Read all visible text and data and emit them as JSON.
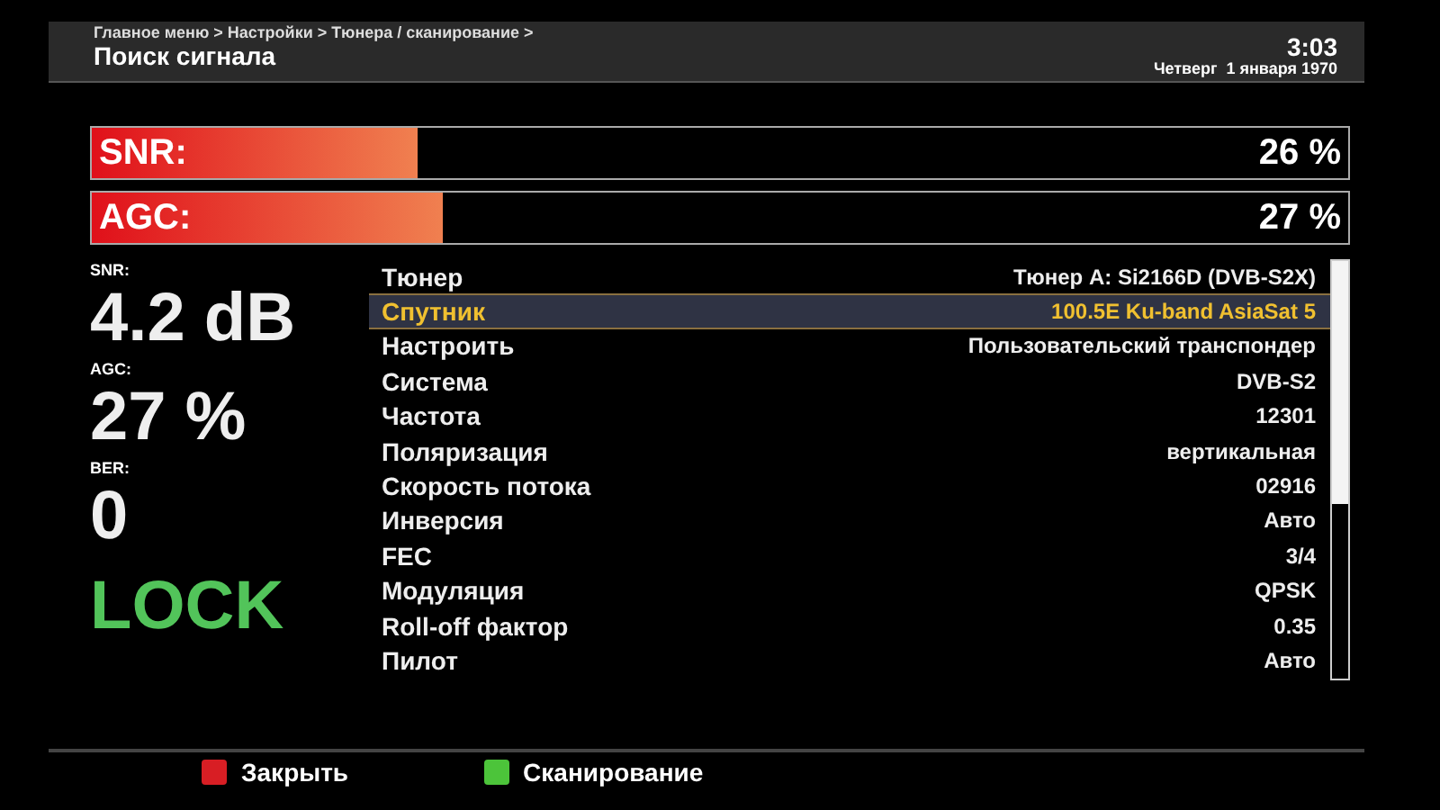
{
  "header": {
    "breadcrumb": "Главное меню > Настройки > Тюнера / сканирование >",
    "title": "Поиск сигнала",
    "time": "3:03",
    "date": "Четверг  1 января 1970"
  },
  "meters": [
    {
      "label": "SNR:",
      "level": 0.26,
      "reading": "26 %"
    },
    {
      "label": "AGC:",
      "level": 0.28,
      "reading": "27 %"
    }
  ],
  "stats": [
    {
      "label": "SNR:",
      "value": "4.2 dB",
      "kind": "value"
    },
    {
      "label": "AGC:",
      "value": "27 %",
      "kind": "value"
    },
    {
      "label": "BER:",
      "value": "0",
      "kind": "value"
    },
    {
      "value": "LOCK",
      "kind": "lock"
    }
  ],
  "settings": [
    {
      "name": "Тюнер",
      "value": "Тюнер A: Si2166D (DVB-S2X)",
      "selected": false
    },
    {
      "name": "Спутник",
      "value": "100.5E Ku-band AsiaSat 5",
      "selected": true
    },
    {
      "name": "Настроить",
      "value": "Пользовательский транспондер",
      "selected": false
    },
    {
      "name": "Система",
      "value": "DVB-S2",
      "selected": false
    },
    {
      "name": "Частота",
      "value": "12301",
      "selected": false
    },
    {
      "name": "Поляризация",
      "value": "вертикальная",
      "selected": false
    },
    {
      "name": "Скорость потока",
      "value": "02916",
      "selected": false
    },
    {
      "name": "Инверсия",
      "value": "Авто",
      "selected": false
    },
    {
      "name": "FEC",
      "value": "3/4",
      "selected": false
    },
    {
      "name": "Модуляция",
      "value": "QPSK",
      "selected": false
    },
    {
      "name": "Roll-off фактор",
      "value": "0.35",
      "selected": false
    },
    {
      "name": "Пилот",
      "value": "Авто",
      "selected": false
    }
  ],
  "footer": [
    {
      "label": "Закрыть",
      "color": "#d81e24"
    },
    {
      "label": "Сканирование",
      "color": "#4cc43a"
    }
  ]
}
